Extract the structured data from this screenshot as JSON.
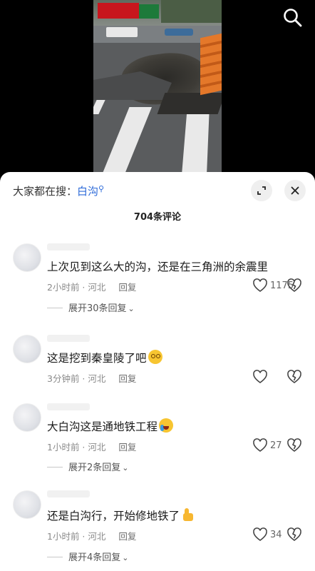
{
  "sheet": {
    "search_prefix": "大家都在搜：",
    "search_keyword": "白沟",
    "comment_count": "704条评论"
  },
  "icons": {
    "search": "search-icon",
    "expand": "expand-icon",
    "close": "close-icon",
    "like": "heart-icon",
    "dislike": "broken-heart-icon"
  },
  "colors": {
    "keyword": "#2e6bd9",
    "sheet_bg": "#ffffff",
    "meta": "#8a8a8a"
  },
  "comments": [
    {
      "text": "上次见到这么大的沟，还是在三角洲的余震里",
      "time": "2小时前",
      "location": "河北",
      "reply": "回复",
      "likes": "1175",
      "expand": "展开30条回复",
      "emoji": ""
    },
    {
      "text": "这是挖到秦皇陵了吧",
      "time": "3分钟前",
      "location": "河北",
      "reply": "回复",
      "likes": "",
      "expand": "",
      "emoji": "dizzy-face"
    },
    {
      "text": "大白沟这是通地铁工程",
      "time": "1小时前",
      "location": "河北",
      "reply": "回复",
      "likes": "27",
      "expand": "展开2条回复",
      "emoji": "crying-face"
    },
    {
      "text": "还是白沟行，开始修地铁了",
      "time": "1小时前",
      "location": "河北",
      "reply": "回复",
      "likes": "34",
      "expand": "展开4条回复",
      "emoji": "thumbs-up"
    }
  ]
}
